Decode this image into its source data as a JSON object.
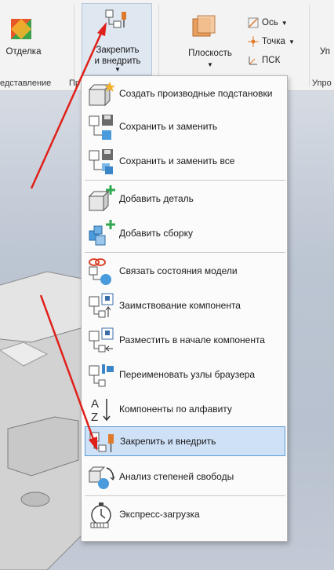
{
  "ribbon": {
    "finish_label": "Отделка",
    "pin_label_line1": "Закрепить",
    "pin_label_line2": "и внедрить",
    "plane_label": "Плоскость",
    "axis_label": "Ось",
    "point_label": "Точка",
    "ucs_label": "ПСК",
    "cut_right_label": "Уп",
    "group_view_label": "едставление",
    "group_pr_label": "Пр",
    "group_right_label": "Упро"
  },
  "menu": {
    "items": [
      {
        "label": "Создать производные подстановки",
        "icon": "derived-substitute-icon"
      },
      {
        "label": "Сохранить и заменить",
        "icon": "save-replace-icon"
      },
      {
        "label": "Сохранить и заменить все",
        "icon": "save-replace-all-icon"
      },
      {
        "label": "Добавить деталь",
        "icon": "add-part-icon"
      },
      {
        "label": "Добавить сборку",
        "icon": "add-assembly-icon"
      },
      {
        "label": "Связать состояния модели",
        "icon": "link-model-states-icon"
      },
      {
        "label": "Заимствование компонента",
        "icon": "borrow-component-icon"
      },
      {
        "label": "Разместить в начале компонента",
        "icon": "place-at-origin-icon"
      },
      {
        "label": "Переименовать узлы браузера",
        "icon": "rename-browser-nodes-icon"
      },
      {
        "label": "Компоненты по алфавиту",
        "icon": "sort-alphabetical-icon"
      },
      {
        "label": "Закрепить и внедрить",
        "icon": "pin-embed-icon"
      },
      {
        "label": "Анализ степеней свободы",
        "icon": "dof-analysis-icon"
      },
      {
        "label": "Экспресс-загрузка",
        "icon": "express-load-icon"
      }
    ]
  },
  "colors": {
    "selected_bg": "#cfe1f7",
    "selected_border": "#5b9bd5",
    "annotation_arrow": "#e0201a"
  }
}
